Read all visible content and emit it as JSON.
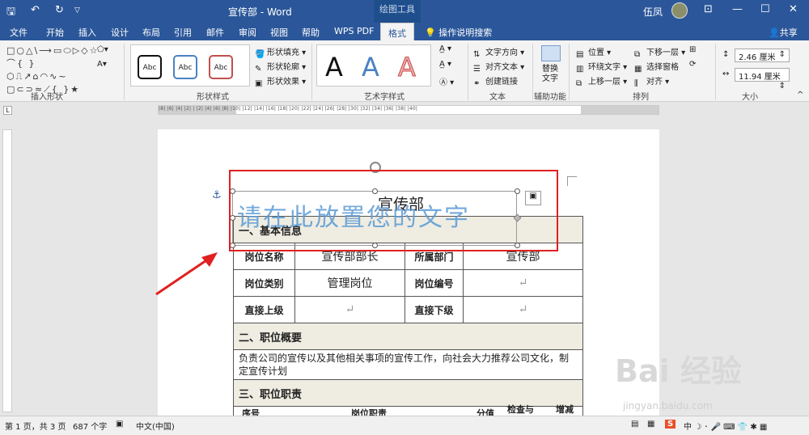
{
  "titlebar": {
    "doc_title": "宣传部 - Word",
    "context_tab": "绘图工具",
    "user": "伍凤",
    "qa_save": "🖫",
    "qa_undo": "↶",
    "qa_redo": "↻",
    "min": "—",
    "max": "☐",
    "close": "✕",
    "ribbon_toggle": "⊡"
  },
  "tabs": [
    "文件",
    "开始",
    "插入",
    "设计",
    "布局",
    "引用",
    "邮件",
    "审阅",
    "视图",
    "帮助",
    "WPS PDF",
    "格式"
  ],
  "tellme": "操作说明搜索",
  "share": "共享",
  "ribbon": {
    "insert_shapes": {
      "label": "插入形状"
    },
    "shape_styles": {
      "label": "形状样式",
      "abc": "Abc",
      "fill": "形状填充",
      "outline": "形状轮廓",
      "effects": "形状效果"
    },
    "wordart_styles": {
      "label": "艺术字样式",
      "a": "A"
    },
    "text": {
      "label": "文本",
      "direction": "文字方向",
      "align": "对齐文本",
      "link": "创建链接"
    },
    "accessibility": {
      "label": "辅助功能",
      "alt": "替换\n文字"
    },
    "arrange": {
      "label": "排列",
      "position": "位置",
      "wrap": "环绕文字",
      "forward": "上移一层",
      "backward": "下移一层",
      "select_pane": "选择窗格",
      "align": "对齐"
    },
    "size": {
      "label": "大小",
      "height": "2.46 厘米",
      "width": "11.94 厘米"
    }
  },
  "ruler_numbers": "|8| |6| |4| |2| | |2| |4| |6| |8| |10| |12| |14| |16| |18| |20| |22| |24| |26| |28| |30| |32| |34| |36| |38| |40|",
  "document": {
    "heading": "宣传部",
    "placeholder": "请在此放置您的文字",
    "sec1": "一、基本信息",
    "row1": {
      "l1": "岗位名称",
      "v1": "宣传部部长",
      "l2": "所属部门",
      "v2": "宣传部"
    },
    "row2": {
      "l1": "岗位类别",
      "v1": "管理岗位",
      "l2": "岗位编号",
      "v2": "↵"
    },
    "row3": {
      "l1": "直接上级",
      "v1": "↵",
      "l2": "直接下级",
      "v2": "↵"
    },
    "sec2": "二、职位概要",
    "summary": "负责公司的宣传以及其他相关事项的宣传工作，向社会大力推荐公司文化，制定宣传计划",
    "sec3": "三、职位职责",
    "row4": {
      "c1": "序号",
      "c2": "岗位职责",
      "c3": "分值",
      "c4": "检查与",
      "c5": "增减"
    }
  },
  "statusbar": {
    "pages": "第 1 页，共 3 页",
    "words": "687 个字",
    "lang": "中文(中国)"
  },
  "watermark": {
    "main": "Bai 经验",
    "url": "jingyan.baidu.com"
  },
  "colors": {
    "accent": "#2b579a",
    "highlight": "#e02020",
    "wordart": "#5b9bd5"
  }
}
